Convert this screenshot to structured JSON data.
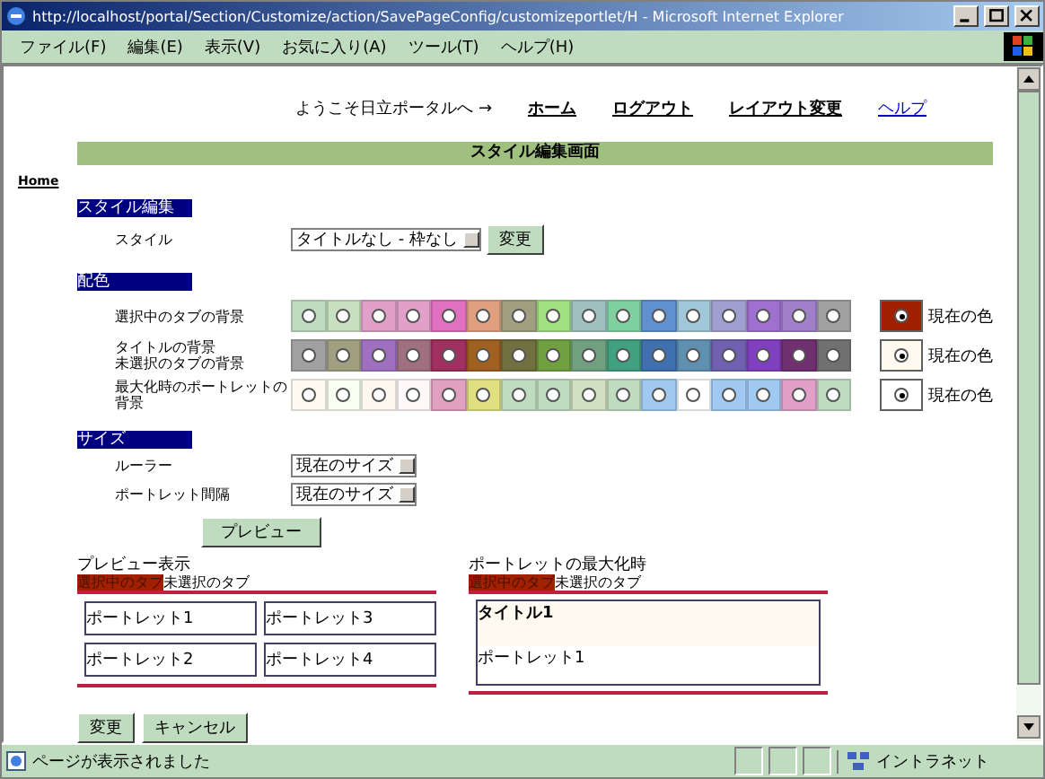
{
  "window": {
    "title": "http://localhost/portal/Section/Customize/action/SavePageConfig/customizeportlet/H - Microsoft Internet Explorer"
  },
  "menu": [
    "ファイル(F)",
    "編集(E)",
    "表示(V)",
    "お気に入り(A)",
    "ツール(T)",
    "ヘルプ(H)"
  ],
  "header": {
    "welcome": "ようこそ日立ポータルへ →",
    "links": [
      {
        "label": "ホーム",
        "visited": true
      },
      {
        "label": "ログアウト",
        "visited": true
      },
      {
        "label": "レイアウト変更",
        "visited": true
      },
      {
        "label": "ヘルプ",
        "visited": false
      }
    ]
  },
  "page_title": "スタイル編集画面",
  "breadcrumb": "Home",
  "style_edit": {
    "heading": "スタイル編集",
    "label": "スタイル",
    "select": "タイトルなし - 枠なし",
    "button": "変更"
  },
  "colors": {
    "heading": "配色",
    "rows": [
      {
        "label": [
          "選択中のタブの背景"
        ],
        "current": {
          "color": "#a02000",
          "selected": true
        },
        "current_label": "現在の色",
        "swatches": [
          {
            "color": "#c0dcc0",
            "selected": false
          },
          {
            "color": "#c8e0c0",
            "selected": false
          },
          {
            "color": "#e0a0c8",
            "selected": false
          },
          {
            "color": "#e0a0c8",
            "selected": false
          },
          {
            "color": "#e070c0",
            "selected": false
          },
          {
            "color": "#e0a080",
            "selected": false
          },
          {
            "color": "#a0a080",
            "selected": false
          },
          {
            "color": "#a0e080",
            "selected": false
          },
          {
            "color": "#a0c0c0",
            "selected": false
          },
          {
            "color": "#80d0a0",
            "selected": false
          },
          {
            "color": "#6090d0",
            "selected": false
          },
          {
            "color": "#a0c8d8",
            "selected": false
          },
          {
            "color": "#a0a0d0",
            "selected": false
          },
          {
            "color": "#a070d0",
            "selected": false
          },
          {
            "color": "#a080c8",
            "selected": false
          },
          {
            "color": "#a0a0a0",
            "selected": false
          }
        ]
      },
      {
        "label": [
          "タイトルの背景",
          "未選択のタブの背景"
        ],
        "current": {
          "color": "#fffaf0",
          "selected": true
        },
        "current_label": "現在の色",
        "swatches": [
          {
            "color": "#a0a0a0",
            "selected": false
          },
          {
            "color": "#a0a080",
            "selected": false
          },
          {
            "color": "#a070c0",
            "selected": false
          },
          {
            "color": "#a07080",
            "selected": false
          },
          {
            "color": "#a03060",
            "selected": false
          },
          {
            "color": "#a06020",
            "selected": false
          },
          {
            "color": "#707040",
            "selected": false
          },
          {
            "color": "#70a040",
            "selected": false
          },
          {
            "color": "#70a080",
            "selected": false
          },
          {
            "color": "#40a080",
            "selected": false
          },
          {
            "color": "#4070b0",
            "selected": false
          },
          {
            "color": "#6090b0",
            "selected": false
          },
          {
            "color": "#7060b0",
            "selected": false
          },
          {
            "color": "#8040c0",
            "selected": false
          },
          {
            "color": "#703070",
            "selected": false
          },
          {
            "color": "#707070",
            "selected": false
          }
        ]
      },
      {
        "label": [
          "最大化時のポートレットの",
          "背景"
        ],
        "current": {
          "color": "#ffffff",
          "selected": true
        },
        "current_label": "現在の色",
        "swatches": [
          {
            "color": "#fffaf0",
            "selected": false
          },
          {
            "color": "#f8fff0",
            "selected": false
          },
          {
            "color": "#fff8f0",
            "selected": false
          },
          {
            "color": "#fff8f8",
            "selected": false
          },
          {
            "color": "#e0a0c0",
            "selected": false
          },
          {
            "color": "#e0e080",
            "selected": false
          },
          {
            "color": "#c0dcc0",
            "selected": false
          },
          {
            "color": "#c0dcc0",
            "selected": false
          },
          {
            "color": "#d0e0c0",
            "selected": false
          },
          {
            "color": "#c0dcc0",
            "selected": false
          },
          {
            "color": "#a0c8f0",
            "selected": false
          },
          {
            "color": "#ffffff",
            "selected": false
          },
          {
            "color": "#a0c8f0",
            "selected": false
          },
          {
            "color": "#a0c8f0",
            "selected": false
          },
          {
            "color": "#e0a0c8",
            "selected": false
          },
          {
            "color": "#c0dcc0",
            "selected": false
          }
        ]
      }
    ]
  },
  "size": {
    "heading": "サイズ",
    "rows": [
      {
        "label": "ルーラー",
        "select": "現在のサイズ"
      },
      {
        "label": "ポートレット間隔",
        "select": "現在のサイズ"
      }
    ]
  },
  "preview_button": "プレビュー",
  "preview": {
    "title": "プレビュー表示",
    "tabs": [
      {
        "label": "選択中のタブ",
        "selected": true
      },
      {
        "label": "未選択のタブ",
        "selected": false
      }
    ],
    "portlets": [
      "ポートレット1",
      "ポートレット3",
      "ポートレット2",
      "ポートレット4"
    ]
  },
  "maximized": {
    "title": "ポートレットの最大化時",
    "tabs": [
      {
        "label": "選択中のタブ",
        "selected": true
      },
      {
        "label": "未選択のタブ",
        "selected": false
      }
    ],
    "portlet_title": "タイトル1",
    "portlet_body": "ポートレット1"
  },
  "buttons": [
    "変更",
    "キャンセル"
  ],
  "status_bar": {
    "text": "ページが表示されました",
    "zone": "イントラネット"
  }
}
